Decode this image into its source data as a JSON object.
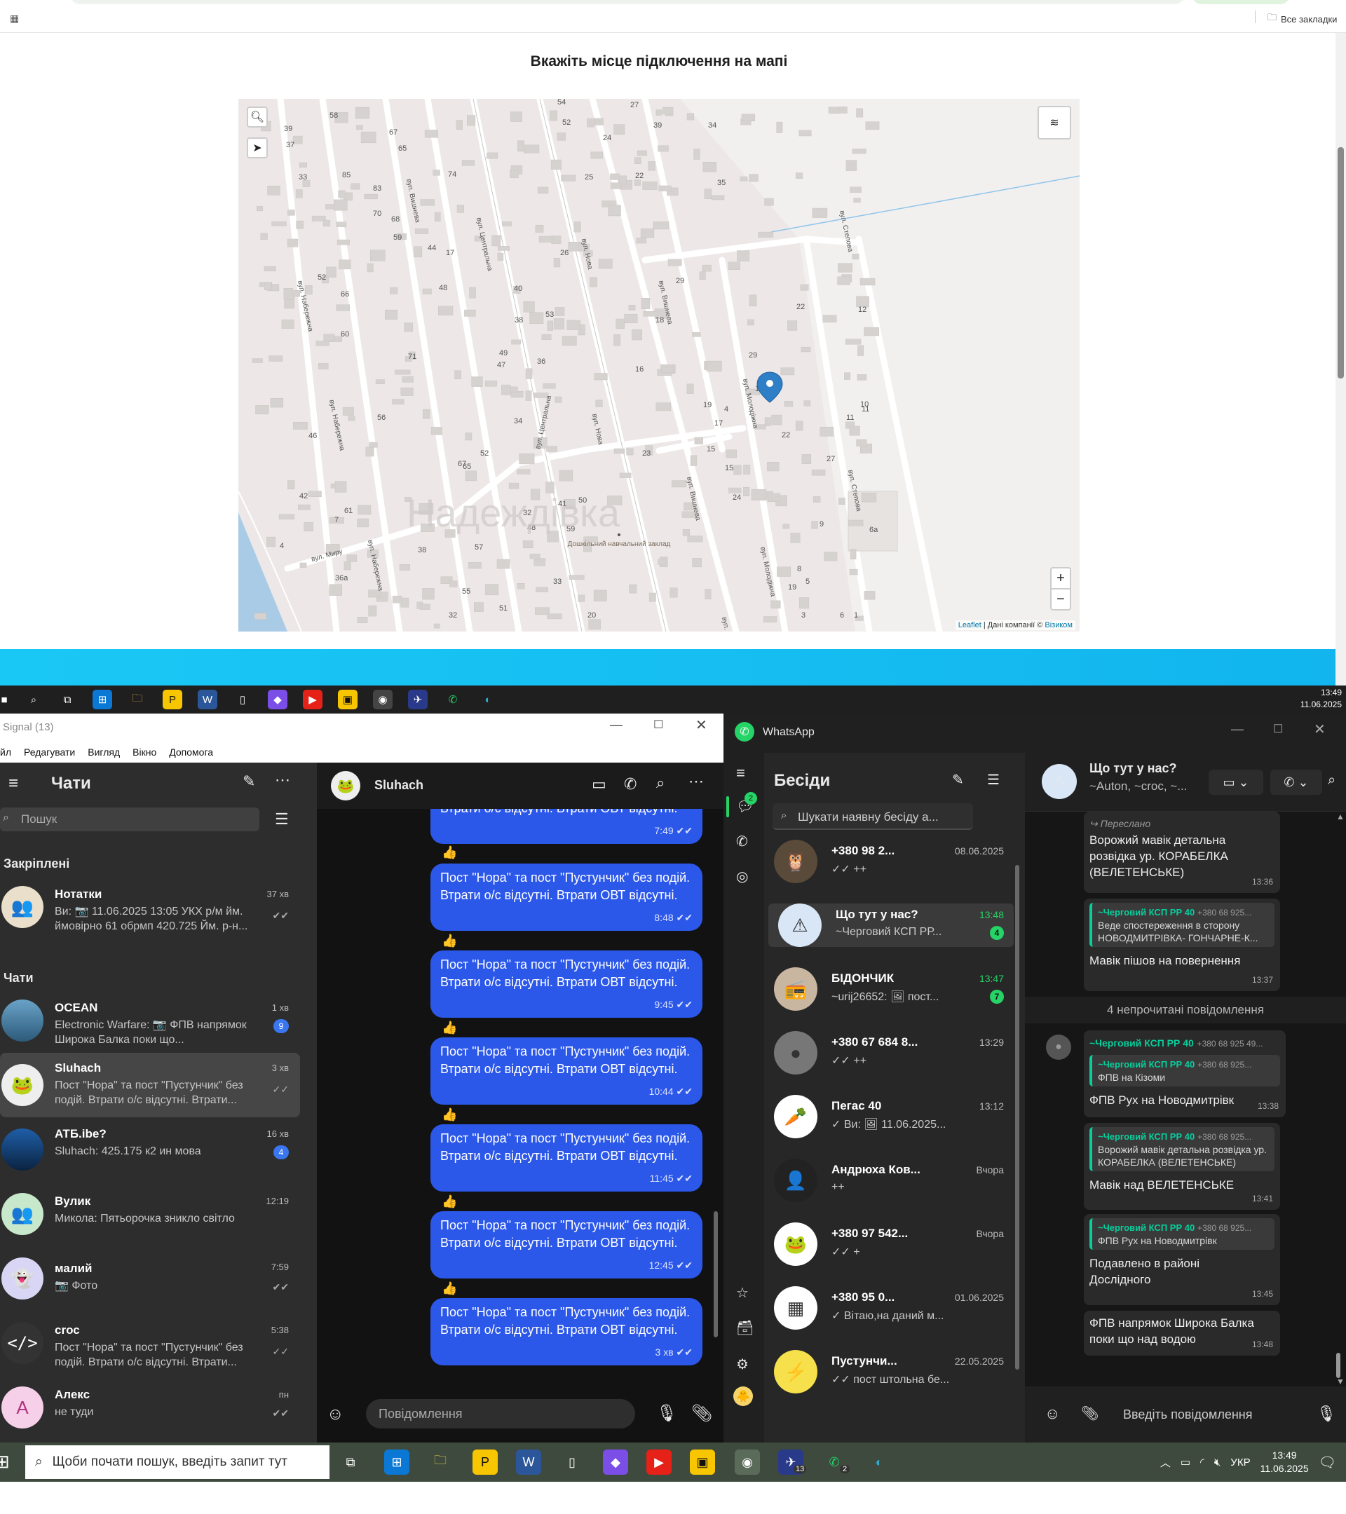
{
  "browser": {
    "bookmarks_label": "Все закладки",
    "heading": "Вкажіть місце підключення на мапі",
    "map": {
      "attribution_leaflet": "Leaflet",
      "attribution_text": "| Дані компанії ©",
      "attribution_provider": "Візиком",
      "village_label": "Надеждівка",
      "school_label": "Дошкільний навчальний заклад",
      "zoom_in": "+",
      "zoom_out": "−",
      "streets": [
        "вул. Центральна",
        "вул. Центральна",
        "вул. Вишнева",
        "вул. Вишнева",
        "вул. Нова",
        "вул. Нова",
        "вул. Молодіжна",
        "вул. Молодіжна",
        "вул. Степова",
        "вул. Степова",
        "вул. Набережна",
        "вул. Набережна",
        "вул. Набережна",
        "вул. Вишнева",
        "вул. Миру",
        "вул. Вишнева"
      ],
      "house_numbers": [
        "54",
        "27",
        "58",
        "52",
        "39",
        "34",
        "39",
        "67",
        "37",
        "65",
        "24",
        "85",
        "74",
        "25",
        "22",
        "35",
        "33",
        "83",
        "70",
        "68",
        "59",
        "44",
        "17",
        "26",
        "29",
        "52",
        "66",
        "48",
        "53",
        "40",
        "18",
        "22",
        "12",
        "60",
        "38",
        "71",
        "49",
        "47",
        "36",
        "16",
        "29",
        "19",
        "11",
        "10",
        "22",
        "46",
        "56",
        "34",
        "17",
        "15",
        "27",
        "67",
        "52",
        "23",
        "42",
        "65",
        "50",
        "32",
        "41",
        "24",
        "61",
        "48",
        "9",
        "38",
        "59",
        "6a",
        "57",
        "8",
        "36a",
        "33",
        "19",
        "5",
        "4",
        "55",
        "3",
        "32",
        "51",
        "20",
        "6",
        "1",
        "15",
        "11",
        "19",
        "4",
        "7"
      ]
    }
  },
  "taskbar_top": {
    "time": "13:49",
    "date": "11.06.2025"
  },
  "signal": {
    "window_title": "Signal (13)",
    "menu": [
      "йл",
      "Редагувати",
      "Вигляд",
      "Вікно",
      "Допомога"
    ],
    "sidebar_title": "Чати",
    "search_placeholder": "Пошук",
    "pinned_header": "Закріплені",
    "chats_header": "Чати",
    "pinned": [
      {
        "name": "Нотатки",
        "time": "37 хв",
        "text": "Ви: 📷 11.06.2025 13:05 УКХ р/м йм. ймовірно 61 обрмп 420.725 Йм. р-н..."
      }
    ],
    "chats": [
      {
        "name": "OCEAN",
        "time": "1 хв",
        "badge": "9",
        "text": "Electronic Warfare: 📷 ФПВ напрямок Широка Балка поки що..."
      },
      {
        "name": "Sluhach",
        "time": "3 хв",
        "text": "Пост \"Нора\" та пост \"Пустунчик\" без подій. Втрати о/с відсутні. Втрати..."
      },
      {
        "name": "АТБ.ibe?",
        "time": "16 хв",
        "badge": "4",
        "text": "Sluhach: 425.175 к2 ин мова"
      },
      {
        "name": "Вулик",
        "time": "12:19",
        "text": "Микола: Пятьорочка зникло світло"
      },
      {
        "name": "малий",
        "time": "7:59",
        "text": "📷 Фото"
      },
      {
        "name": "crос",
        "time": "5:38",
        "text": "Пост \"Нора\" та пост \"Пустунчик\" без подій. Втрати о/с відсутні. Втрати..."
      },
      {
        "name": "Алекс",
        "time": "пн",
        "text": "не туди",
        "avatar_letter": "A"
      }
    ],
    "conversation": {
      "name": "Sluhach",
      "partial_message": "Пост \"Нора\" та пост \"Пустунчик\" без подій. Втрати о/с відсутні. Втрати ОВТ відсутні.",
      "partial_time": "7:49",
      "message_text": "Пост \"Нора\" та пост \"Пустунчик\"  без подій. Втрати о/с відсутні. Втрати ОВТ відсутні.",
      "messages": [
        {
          "time": "8:48"
        },
        {
          "time": "9:45"
        },
        {
          "time": "10:44"
        },
        {
          "time": "11:45"
        },
        {
          "time": "12:45"
        },
        {
          "time": "3 хв"
        }
      ],
      "reaction": "👍",
      "composer_placeholder": "Повідомлення"
    }
  },
  "whatsapp": {
    "window_title": "WhatsApp",
    "list_title": "Бесіди",
    "rail_badge": "2",
    "search_placeholder": "Шукати наявну бесіду а...",
    "chats": [
      {
        "name": "+380 98 2...",
        "time": "08.06.2025",
        "text": "✓✓ ++"
      },
      {
        "name": "Що тут у нас?",
        "time": "13:48",
        "badge": "4",
        "text": "~Черговий КСП РР..."
      },
      {
        "name": "БІДОНЧИК",
        "time": "13:47",
        "badge": "7",
        "text": "~urij26652: 🖼 пост..."
      },
      {
        "name": "+380 67 684 8...",
        "time": "13:29",
        "text": "✓✓ ++"
      },
      {
        "name": "Пегас 40",
        "time": "13:12",
        "text": "✓ Ви: 🖼 11.06.2025..."
      },
      {
        "name": "Андрюха Ков...",
        "time": "Вчора",
        "text": "++"
      },
      {
        "name": "+380 97 542...",
        "time": "Вчора",
        "text": "✓✓ +"
      },
      {
        "name": "+380 95 0...",
        "time": "01.06.2025",
        "text": "✓ Вітаю,на даний м..."
      },
      {
        "name": "Пустунчи...",
        "time": "22.05.2025",
        "text": "✓✓ пост штольна бе..."
      }
    ],
    "chat": {
      "name": "Що тут у нас?",
      "members": "~Auton, ~crос, ~...",
      "forwarded_label": "Переслано",
      "forwarded_text": "Ворожий мавік детальна розвідка  ур. КОРАБЕЛКА (ВЕЛЕТЕНСЬКЕ)",
      "forwarded_time": "13:36",
      "unread_divider": "4 непрочитані повідомлення",
      "sender": "~Черговий КСП РР 40",
      "sender_number": "+380 68 925 49...",
      "quote_number": "+380 68 925...",
      "messages": [
        {
          "quote": "Веде спостереження в сторону НОВОДМИТРІВКА- ГОНЧАРНЕ-К...",
          "text": "Мавік пішов на повернення",
          "time": "13:37"
        },
        {
          "quote": "ФПВ на Кізоми",
          "text": "ФПВ Рух на Новодмитрівк",
          "time": "13:38"
        },
        {
          "quote": "Ворожий мавік детальна розвідка  ур. КОРАБЕЛКА (ВЕЛЕТЕНСЬКЕ)",
          "text": "Мавік над ВЕЛЕТЕНСЬКЕ",
          "time": "13:41"
        },
        {
          "quote": "ФПВ Рух на Новодмитрівк",
          "text": "Подавлено в районі Дослідного",
          "time": "13:45"
        },
        {
          "text": "ФПВ напрямок Широка Балка поки що над водою",
          "time": "13:48"
        }
      ],
      "composer_placeholder": "Введіть повідомлення"
    }
  },
  "taskbar_bottom": {
    "search_placeholder": "Щоби почати пошук, введіть запит тут",
    "lang": "УКР",
    "time": "13:49",
    "date": "11.06.2025",
    "telegram_badge": "13",
    "whatsapp_badge": "2"
  }
}
